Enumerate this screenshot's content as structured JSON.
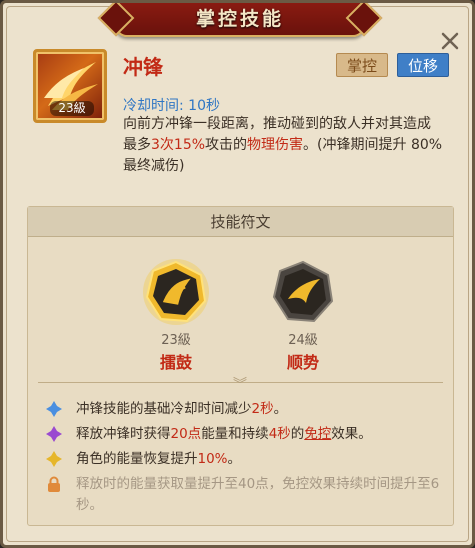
{
  "title": "掌控技能",
  "close_icon": "close-icon",
  "skill": {
    "name": "冲锋",
    "level": "23級",
    "tags": [
      "掌控",
      "位移"
    ],
    "cooldown": "冷却时间: 10秒",
    "desc": {
      "part1": "向前方冲锋一段距离，推动碰到的敌人并对其造成最多",
      "hits": "3次",
      "pct": "15%",
      "part2": "攻击的",
      "dmg": "物理伤害",
      "part3": "。(冲锋期间提升 80% 最终减伤)"
    }
  },
  "runes": {
    "header": "技能符文",
    "items": [
      {
        "level": "23級",
        "name": "擂鼓"
      },
      {
        "level": "24級",
        "name": "顺势"
      }
    ]
  },
  "effects": [
    {
      "icon": "blue-diamond-icon",
      "pre": "冲锋技能的基础冷却时间减少",
      "hl": "2秒",
      "post": "。"
    },
    {
      "icon": "purple-diamond-icon",
      "pre": "释放冲锋时获得",
      "hl": "20点",
      "mid": "能量和持续",
      "hl2": "4秒",
      "mid2": "的",
      "link": "免控",
      "post": "效果。"
    },
    {
      "icon": "yellow-diamond-icon",
      "pre": "角色的能量恢复提升",
      "hl": "10%",
      "post": "。"
    },
    {
      "icon": "lock-icon",
      "text": "释放时的能量获取量提升至40点，免控效果持续时间提升至6秒。"
    }
  ],
  "colors": {
    "accent_red": "#c22a16",
    "cooldown_blue": "#2f76c4",
    "panel_bg": "#ece2cd"
  }
}
